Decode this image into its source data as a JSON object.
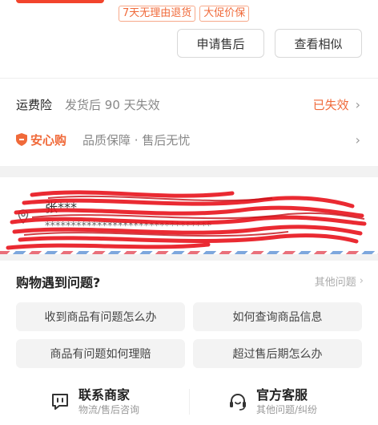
{
  "order": {
    "tags": [
      "7天无理由退货",
      "大促价保"
    ],
    "actions": [
      "申请售后",
      "查看相似"
    ]
  },
  "insurance": {
    "label": "运费险",
    "desc": "发货后 90 天失效",
    "status": "已失效"
  },
  "assurance": {
    "badge": "安心购",
    "desc": "品质保障 · 售后无忧"
  },
  "address": {
    "name": "张***",
    "detail": "********************************"
  },
  "help": {
    "title": "购物遇到问题?",
    "more": "其他问题",
    "questions": [
      "收到商品有问题怎么办",
      "如何查询商品信息",
      "商品有问题如何理赔",
      "超过售后期怎么办"
    ]
  },
  "contact": {
    "merchant": {
      "title": "联系商家",
      "sub": "物流/售后咨询"
    },
    "service": {
      "title": "官方客服",
      "sub": "其他问题/纠纷"
    }
  },
  "colors": {
    "accent": "#f06a3a",
    "scribble": "#e8141c"
  }
}
